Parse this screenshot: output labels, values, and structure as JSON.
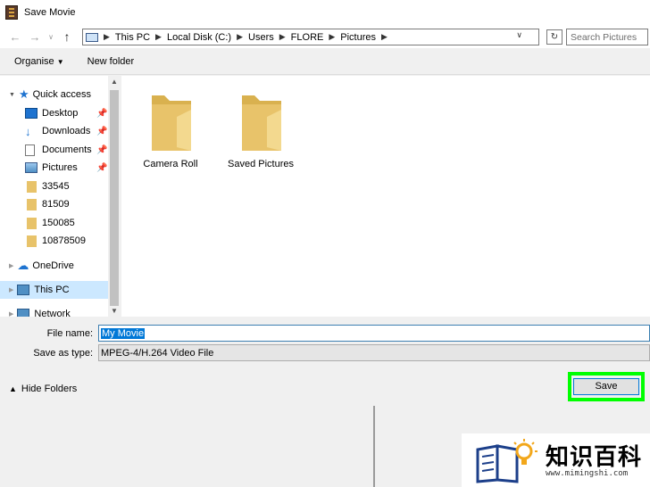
{
  "window": {
    "title": "Save Movie"
  },
  "nav": {
    "crumbs": [
      "This PC",
      "Local Disk (C:)",
      "Users",
      "FLORE",
      "Pictures"
    ],
    "search_placeholder": "Search Pictures"
  },
  "toolbar": {
    "organise": "Organise",
    "new_folder": "New folder"
  },
  "sidebar": {
    "items": [
      {
        "label": "Quick access",
        "icon": "star-icon"
      },
      {
        "label": "Desktop",
        "icon": "desktop-icon",
        "pinned": true
      },
      {
        "label": "Downloads",
        "icon": "download-icon",
        "pinned": true
      },
      {
        "label": "Documents",
        "icon": "documents-icon",
        "pinned": true
      },
      {
        "label": "Pictures",
        "icon": "pictures-icon",
        "pinned": true
      },
      {
        "label": "33545",
        "icon": "folder-icon"
      },
      {
        "label": "81509",
        "icon": "folder-icon"
      },
      {
        "label": "150085",
        "icon": "folder-icon"
      },
      {
        "label": "10878509",
        "icon": "folder-icon"
      },
      {
        "label": "OneDrive",
        "icon": "cloud-icon"
      },
      {
        "label": "This PC",
        "icon": "computer-icon",
        "selected": true
      },
      {
        "label": "Network",
        "icon": "network-icon"
      }
    ]
  },
  "content": {
    "folders": [
      {
        "label": "Camera Roll"
      },
      {
        "label": "Saved Pictures"
      }
    ]
  },
  "form": {
    "file_name_label": "File name:",
    "file_name_value": "My Movie",
    "save_as_type_label": "Save as type:",
    "save_as_type_value": "MPEG-4/H.264 Video File",
    "hide_folders": "Hide Folders",
    "save_label": "Save"
  },
  "watermark": {
    "text": "知识百科",
    "url": "www.mimingshi.com"
  },
  "colors": {
    "folder": "#e8c36a",
    "selection": "#cce8ff",
    "highlight": "#00ff00",
    "accent": "#0078d7"
  }
}
